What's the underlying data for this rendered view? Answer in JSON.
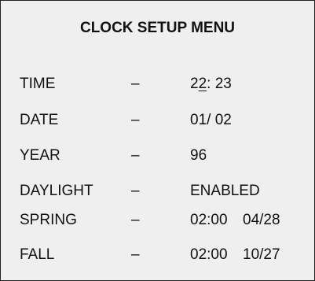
{
  "menu": {
    "title": "CLOCK SETUP MENU",
    "rows": [
      {
        "label": "TIME",
        "sep": "–",
        "value_pre": "2",
        "value_cursor": "2",
        "value_post": ": 23"
      },
      {
        "label": "DATE",
        "sep": "–",
        "value": "01/ 02"
      },
      {
        "label": "YEAR",
        "sep": "–",
        "value": "96"
      },
      {
        "label": "DAYLIGHT",
        "sep": "–",
        "value": "ENABLED"
      },
      {
        "label": "SPRING",
        "sep": "–",
        "value": "02:00",
        "value2": "04/28"
      },
      {
        "label": "FALL",
        "sep": "–",
        "value": "02:00",
        "value2": "10/27"
      }
    ]
  }
}
